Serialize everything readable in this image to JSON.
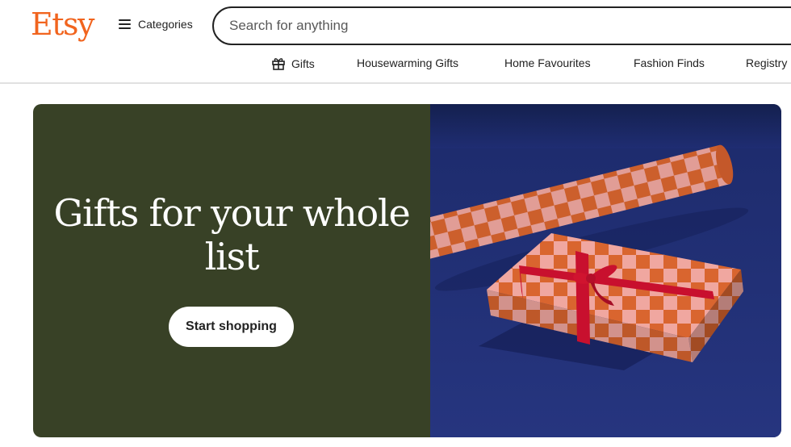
{
  "header": {
    "logo": "Etsy",
    "categories_label": "Categories",
    "search_placeholder": "Search for anything"
  },
  "nav": {
    "items": [
      {
        "label": "Gifts",
        "icon": "gift-icon"
      },
      {
        "label": "Housewarming Gifts"
      },
      {
        "label": "Home Favourites"
      },
      {
        "label": "Fashion Finds"
      },
      {
        "label": "Registry"
      }
    ]
  },
  "hero": {
    "title": "Gifts for your whole list",
    "cta_label": "Start shopping",
    "image_description_icon": "checkered-gift-wrap-image"
  },
  "colors": {
    "brand": "#F1641E",
    "hero_left_bg": "#384126",
    "hero_right_bg": "#1d2a6b",
    "check_orange": "#D9652F",
    "check_pink": "#F0A7A0",
    "ribbon_red": "#C8102E"
  }
}
